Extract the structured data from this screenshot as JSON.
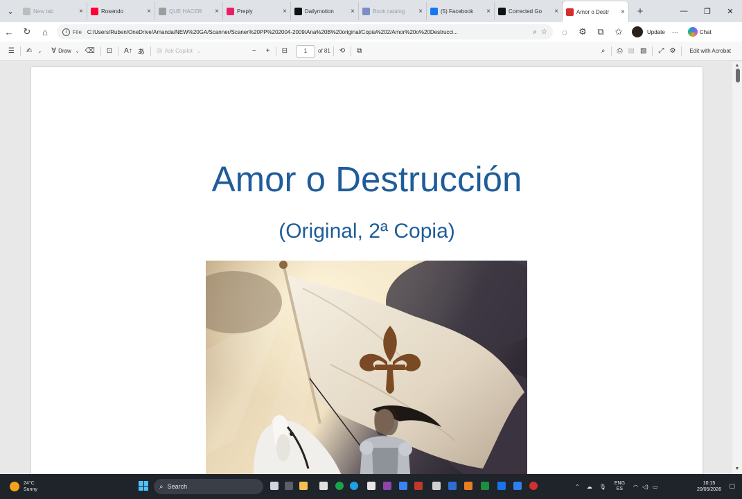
{
  "browser": {
    "tabs": [
      {
        "title": "New tab",
        "color": "#bdbdbd",
        "dim": true
      },
      {
        "title": "Rosendo",
        "color": "#ff0033",
        "dim": false
      },
      {
        "title": "QUE HACER",
        "color": "#9e9e9e",
        "dim": true
      },
      {
        "title": "Preply",
        "color": "#e91e63",
        "dim": false
      },
      {
        "title": "Dailymotion",
        "color": "#111111",
        "dim": false
      },
      {
        "title": "Book catalog",
        "color": "#7c8cc4",
        "dim": true
      },
      {
        "title": "(5) Facebook",
        "color": "#1877f2",
        "dim": false
      },
      {
        "title": "Corrected Go",
        "color": "#111111",
        "dim": false
      },
      {
        "title": "Amor o Destr",
        "color": "#d32f2f",
        "dim": false
      }
    ],
    "address": {
      "file_label": "File",
      "path": "C:/Users/Ruben/OneDrive/Amanda/NEW%20GA/Scanner/Scaner%20PP%202004-2009/Ana%20B%20original/Copia%202/Amor%20o%20Destrucci..."
    },
    "update_label": "Update",
    "chat_label": "Chat"
  },
  "pdf_toolbar": {
    "draw_label": "Draw",
    "ask_copilot_label": "Ask Copilot",
    "page_current": "1",
    "page_total": "of 81",
    "edit_acrobat_label": "Edit with Acrobat"
  },
  "document": {
    "title": "Amor o Destrucción",
    "subtitle": "(Original, 2ª Copia)"
  },
  "taskbar": {
    "weather_temp": "24°C",
    "weather_desc": "Sunny",
    "search_label": "Search",
    "lang_1": "ENG",
    "lang_2": "ES",
    "time": "10:15",
    "date": "20/05/2026"
  },
  "colors": {
    "title_blue": "#1f5c99",
    "taskbar_bg": "#1f232a"
  }
}
